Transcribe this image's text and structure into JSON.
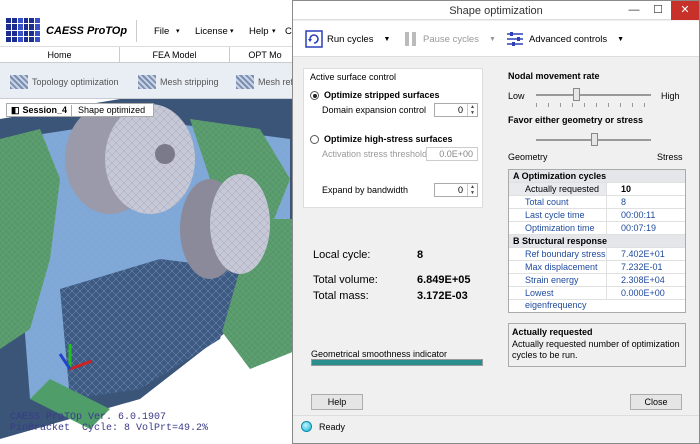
{
  "app": {
    "name": "CAESS ProTOp",
    "menu": [
      "File",
      "License",
      "Help"
    ],
    "menu_last": "CT",
    "ribbon_tabs": [
      "Home",
      "FEA Model",
      "OPT Mo"
    ],
    "ribbon_buttons": [
      "Topology optimization",
      "Mesh stripping",
      "Mesh refi"
    ],
    "session": {
      "name": "Session_4",
      "view": "Shape optimized"
    },
    "viewport_text": "CAESS ProTOp Ver. 6.0.1907\nPinBracket  Cycle: 8 VolPrt=49.2%"
  },
  "dialog": {
    "title": "Shape optimization",
    "controls": {
      "minimize": "—",
      "maximize": "☐",
      "close": "✕"
    },
    "toolbar": {
      "run": "Run cycles",
      "pause": "Pause cycles",
      "advanced": "Advanced controls"
    },
    "active_surface": {
      "title": "Active surface control",
      "opt_stripped": "Optimize stripped surfaces",
      "domain_label": "Domain expansion control",
      "domain_value": "0",
      "opt_high": "Optimize high-stress surfaces",
      "activation_label": "Activation stress threshold",
      "activation_value": "0.0E+00",
      "bandwidth_label": "Expand by bandwidth",
      "bandwidth_value": "0"
    },
    "stats": {
      "local_cycle_label": "Local cycle:",
      "local_cycle": "8",
      "volume_label": "Total volume:",
      "volume": "6.849E+05",
      "mass_label": "Total mass:",
      "mass": "3.172E-03"
    },
    "smoothness": {
      "label": "Geometrical smoothness indicator",
      "fraction": 1.0
    },
    "nodal": {
      "label": "Nodal movement rate",
      "low": "Low",
      "high": "High",
      "level": 0.35
    },
    "favor": {
      "label": "Favor either geometry or stress",
      "left": "Geometry",
      "right": "Stress",
      "level": 0.5
    },
    "grid": {
      "cat_a": "A  Optimization cycles",
      "rows_a": [
        {
          "label": "Actually requested",
          "value": "10"
        },
        {
          "label": "Total count",
          "value": "8"
        },
        {
          "label": "Last cycle time",
          "value": "00:00:11"
        },
        {
          "label": "Optimization time",
          "value": "00:07:19"
        }
      ],
      "cat_b": "B  Structural response",
      "rows_b": [
        {
          "label": "Ref boundary stress",
          "value": "7.402E+01"
        },
        {
          "label": "Max displacement",
          "value": "7.232E-01"
        },
        {
          "label": "Strain energy",
          "value": "2.308E+04"
        },
        {
          "label": "Lowest eigenfrequency",
          "value": "0.000E+00"
        }
      ]
    },
    "description": {
      "title": "Actually requested",
      "body": "Actually requested number of optimization cycles to be run."
    },
    "help_button": "Help",
    "close_button": "Close",
    "status": "Ready",
    "colors": {
      "led": "#12b6d8",
      "smooth": "#2a8e8e",
      "close_red": "#c7312a"
    }
  }
}
